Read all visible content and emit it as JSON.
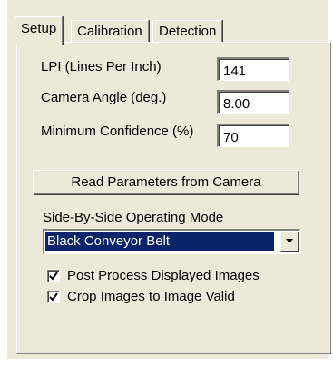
{
  "tabs": [
    {
      "label": "Setup",
      "active": true
    },
    {
      "label": "Calibration",
      "active": false
    },
    {
      "label": "Detection",
      "active": false
    }
  ],
  "setup": {
    "lpi": {
      "label": "LPI (Lines Per Inch)",
      "value": "141"
    },
    "camera_angle": {
      "label": "Camera Angle (deg.)",
      "value": "8.00"
    },
    "min_confidence": {
      "label": "Minimum Confidence (%)",
      "value": "70"
    },
    "read_button": "Read Parameters from Camera",
    "mode": {
      "label": "Side-By-Side Operating Mode",
      "selected": "Black Conveyor Belt"
    },
    "post_process": {
      "label": "Post Process Displayed Images",
      "checked": true
    },
    "crop_images": {
      "label": "Crop Images to Image Valid",
      "checked": true
    }
  },
  "colors": {
    "face": "#ece9d8",
    "highlight": "#0a246a"
  },
  "icons": {
    "dropdown": "chevron-down-icon",
    "check": "check-icon"
  }
}
